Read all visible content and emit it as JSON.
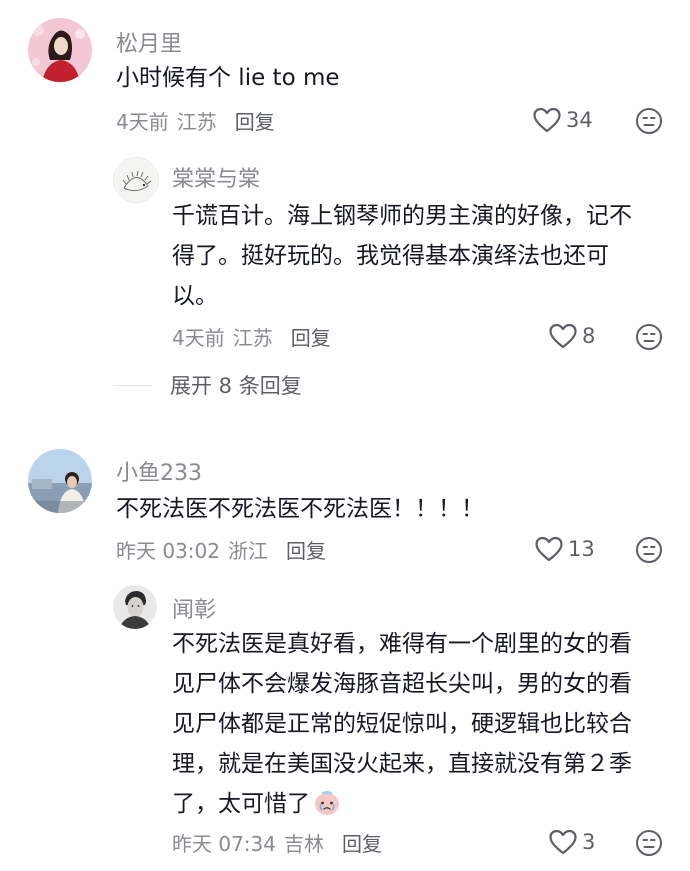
{
  "comments": [
    {
      "author": "松月里",
      "text": "小时候有个 lie to me",
      "time": "4天前",
      "location": "江苏",
      "reply_label": "回复",
      "likes": "34",
      "avatar_icon": "woman-in-red-avatar",
      "replies": [
        {
          "author": "棠棠与棠",
          "text_lines": [
            "千谎百计。海上钢琴师的男主演的好像，记不",
            "得了。挺好玩的。我觉得基本演绎法也还可",
            "以。"
          ],
          "time": "4天前",
          "location": "江苏",
          "reply_label": "回复",
          "likes": "8",
          "avatar_icon": "hedgehog-sketch-avatar"
        }
      ],
      "expand_label": "展开 8 条回复"
    },
    {
      "author": "小鱼233",
      "text": "不死法医不死法医不死法医！！！！",
      "time": "昨天 03:02",
      "location": "浙江",
      "reply_label": "回复",
      "likes": "13",
      "avatar_icon": "person-seaside-avatar",
      "replies": [
        {
          "author": "闻彰",
          "text_lines": [
            "不死法医是真好看，难得有一个剧里的女的看",
            "见尸体不会爆发海豚音超长尖叫，男的女的看",
            "见尸体都是正常的短促惊叫，硬逻辑也比较合",
            "理，就是在美国没火起来，直接就没有第２季",
            "了，太可惜了"
          ],
          "time": "昨天 07:34",
          "location": "吉林",
          "reply_label": "回复",
          "likes": "3",
          "avatar_icon": "man-portrait-avatar",
          "trailing_emoji": "crying-face-emoji"
        }
      ]
    }
  ],
  "colors": {
    "primary_text": "#161823",
    "secondary_text": "#8a8b91",
    "action_text": "#5d5f66",
    "divider": "#e3e3e4"
  }
}
